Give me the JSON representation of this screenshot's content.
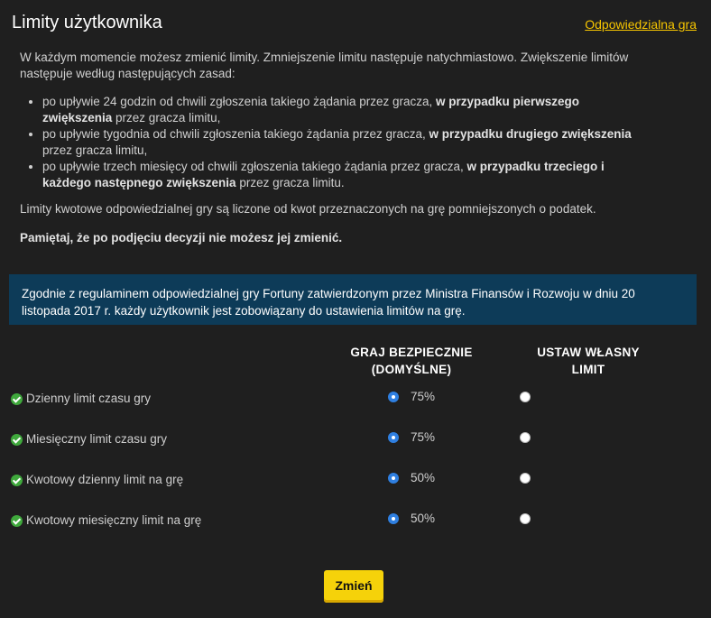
{
  "header": {
    "title": "Limity użytkownika",
    "link_label": "Odpowiedzialna gra"
  },
  "intro": {
    "paragraph1": "W każdym momencie możesz zmienić limity. Zmniejszenie limitu następuje natychmiastowo. Zwiększenie limitów następuje według następujących zasad:",
    "rules": [
      {
        "text": "po upływie 24 godzin od chwili zgłoszenia takiego żądania przez gracza, ",
        "bold": "w przypadku pierwszego zwiększenia",
        "tail": " przez gracza limitu,"
      },
      {
        "text": "po upływie tygodnia od chwili zgłoszenia takiego żądania przez gracza, ",
        "bold": "w przypadku drugiego zwiększenia",
        "tail": " przez gracza limitu,"
      },
      {
        "text": "po upływie trzech miesięcy od chwili zgłoszenia takiego żądania przez gracza, ",
        "bold": "w przypadku trzeciego i każdego następnego zwiększenia",
        "tail": " przez gracza limitu."
      }
    ],
    "paragraph2": "Limity kwotowe odpowiedzialnej gry są liczone od kwot przeznaczonych na grę pomniejszonych o podatek.",
    "paragraph3": "Pamiętaj, że po podjęciu decyzji nie możesz jej zmienić."
  },
  "notice": "Zgodnie z regulaminem odpowiedzialnej gry Fortuny zatwierdzonym przez Ministra Finansów i Rozwoju w dniu 20 listopada 2017 r. każdy użytkownik jest zobowiązany do ustawienia limitów na grę.",
  "columns": {
    "safe_line1": "GRAJ BEZPIECZNIE",
    "safe_line2": "(DOMYŚLNE)",
    "custom_line1": "USTAW WŁASNY",
    "custom_line2": "LIMIT"
  },
  "limits": [
    {
      "label": "Dzienny limit czasu gry",
      "default_value": "75%",
      "selected": "default"
    },
    {
      "label": "Miesięczny limit czasu gry",
      "default_value": "75%",
      "selected": "default"
    },
    {
      "label": "Kwotowy dzienny limit na grę",
      "default_value": "50%",
      "selected": "default"
    },
    {
      "label": "Kwotowy miesięczny limit na grę",
      "default_value": "50%",
      "selected": "default"
    }
  ],
  "submit_label": "Zmień",
  "colors": {
    "background": "#1f1f1f",
    "accent": "#f7c600",
    "notice_bg": "#0d3b58",
    "check": "#3fa83c",
    "radio_on": "#2f7fe0"
  }
}
